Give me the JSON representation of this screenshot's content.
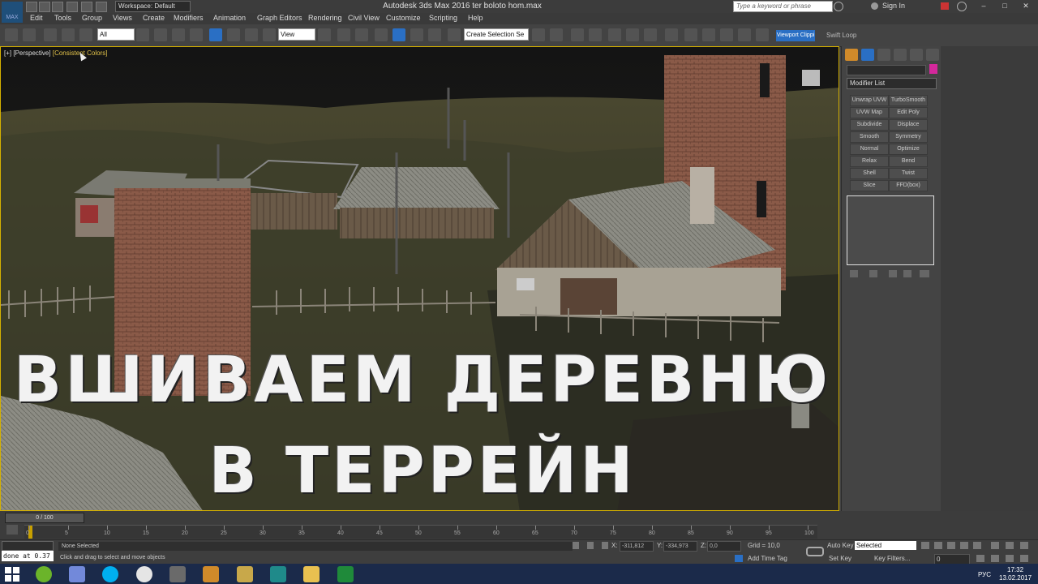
{
  "window": {
    "title": "Autodesk 3ds Max 2016      ter boloto hom.max",
    "workspace": "Workspace: Default",
    "search_placeholder": "Type a keyword or phrase",
    "sign_in": "Sign In",
    "min": "–",
    "max": "□",
    "close": "✕"
  },
  "menu": {
    "logo": "MAX",
    "items": [
      "Edit",
      "Tools",
      "Group",
      "Views",
      "Create",
      "Modifiers",
      "Animation",
      "Graph Editors",
      "Rendering",
      "Civil View",
      "Customize",
      "Scripting",
      "Help"
    ]
  },
  "toolbar": {
    "filter": "All",
    "ref_coord": "View",
    "selection_set": "Create Selection Se",
    "viewport_clipping": "Viewport Clippi",
    "swift_loop": "Swift Loop"
  },
  "viewport": {
    "label_plus": "[+]",
    "label_view": "[Perspective]",
    "label_shading": "[Consistent Colors]",
    "overlay_line1": "ВШИВАЕМ ДЕРЕВНЮ",
    "overlay_line2": "В ТЕРРЕЙН"
  },
  "command_panel": {
    "modifier_list": "Modifier List",
    "buttons": [
      "Unwrap UVW",
      "TurboSmooth",
      "UVW Map",
      "Edit Poly",
      "Subdivide",
      "Displace",
      "Smooth",
      "Symmetry",
      "Normal",
      "Optimize",
      "Relax",
      "Bend",
      "Shell",
      "Twist",
      "Slice",
      "FFD(box)"
    ],
    "object_color": "#d4289c"
  },
  "timeline": {
    "slider": "0 / 100",
    "ticks": [
      "0",
      "5",
      "10",
      "15",
      "20",
      "25",
      "30",
      "35",
      "40",
      "45",
      "50",
      "55",
      "60",
      "65",
      "70",
      "75",
      "80",
      "85",
      "90",
      "95",
      "100"
    ]
  },
  "status": {
    "maxscript": "done at 0.37",
    "selection": "None Selected",
    "hint": "Click and drag to select and move objects",
    "x_label": "X:",
    "x_value": "-311,812",
    "y_label": "Y:",
    "y_value": "-334,973",
    "z_label": "Z:",
    "z_value": "0,0",
    "grid": "Grid = 10,0",
    "add_time_tag": "Add Time Tag",
    "auto_key": "Auto Key",
    "set_key": "Set Key",
    "selected": "Selected",
    "key_filters": "Key Filters...",
    "frame": "0"
  },
  "taskbar": {
    "lang": "РУС",
    "time": "17:32",
    "date": "13.02.2017"
  }
}
